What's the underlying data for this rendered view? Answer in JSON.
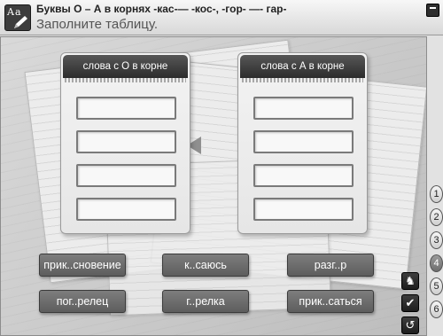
{
  "header": {
    "title": "Буквы О – А в корнях  -кас-— -кос-, -гор- —- гар-",
    "subtitle": "Заполните таблицу.",
    "icon_text": "Aa"
  },
  "columns": [
    {
      "label": "слова с О в корне"
    },
    {
      "label": "слова с А в корне"
    }
  ],
  "words": [
    "прик..сновение",
    "к..саюсь",
    "разг..р",
    "пог..релец",
    "г..релка",
    "прик..саться"
  ],
  "steps": [
    "1",
    "2",
    "3",
    "4",
    "5",
    "6"
  ],
  "active_step": "4",
  "controls": {
    "hint_icon": "chess-knight-icon",
    "check_icon": "check-icon",
    "reset_icon": "undo-icon",
    "hint_glyph": "♞",
    "check_glyph": "✔",
    "reset_glyph": "↺"
  }
}
